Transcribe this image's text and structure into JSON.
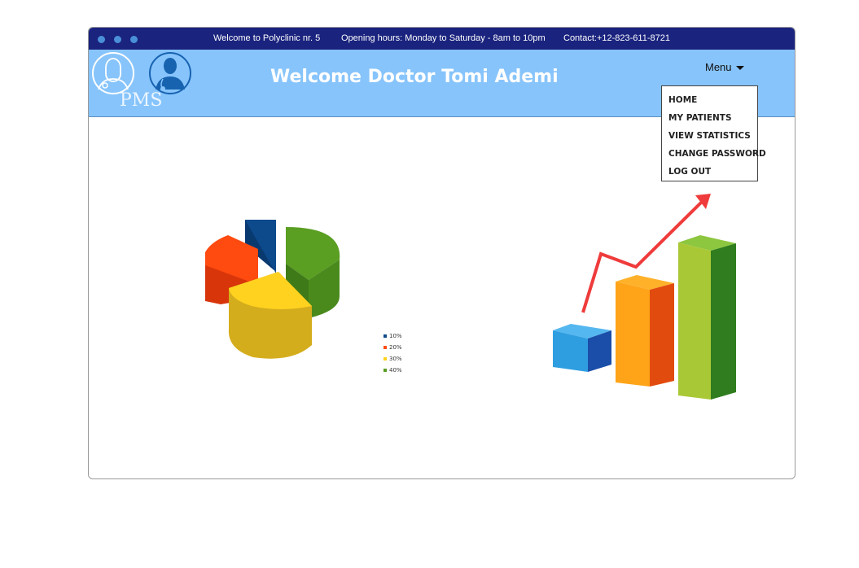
{
  "topbar": {
    "welcome": "Welcome to Polyclinic nr. 5",
    "hours": "Opening hours: Monday to Saturday - 8am to 10pm",
    "contact": "Contact:+12-823-611-8721"
  },
  "header": {
    "logo_text": "PMS",
    "title": "Welcome Doctor Tomi Ademi",
    "menu_label": "Menu"
  },
  "menu": {
    "items": [
      "HOME",
      "MY PATIENTS",
      "VIEW STATISTICS",
      "CHANGE PASSWORD",
      "LOG OUT"
    ]
  },
  "pie_legend": [
    {
      "label": "10%",
      "color": "#0d4a8c"
    },
    {
      "label": "20%",
      "color": "#ff4a10"
    },
    {
      "label": "30%",
      "color": "#ffd21f"
    },
    {
      "label": "40%",
      "color": "#5a9e22"
    }
  ],
  "colors": {
    "topbar": "#1a237e",
    "header": "#87c4fb",
    "arrow": "#ef3b3b"
  }
}
